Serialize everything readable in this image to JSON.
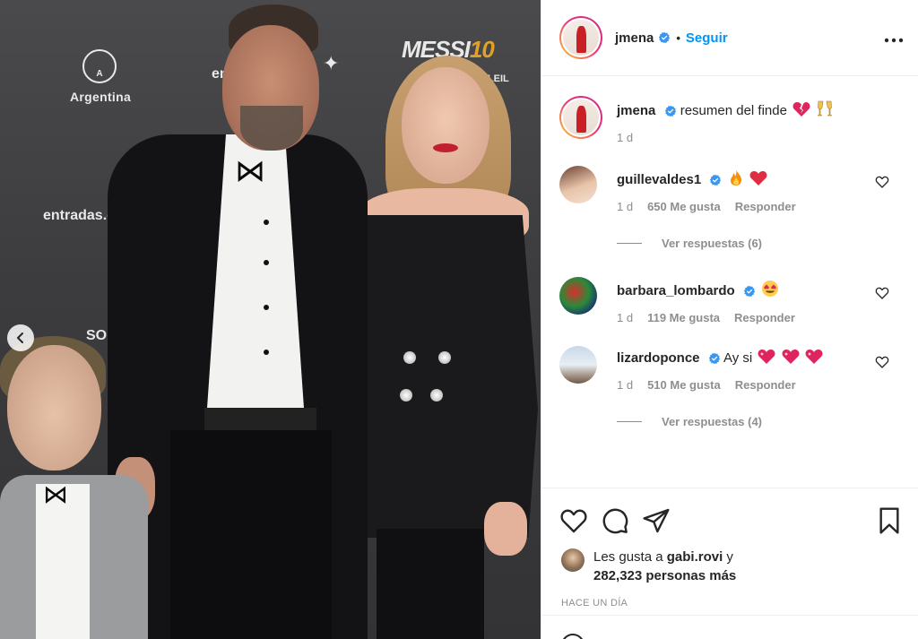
{
  "post": {
    "author": "jmena",
    "follow_label": "Seguir",
    "separator": "•",
    "more_label": "•••"
  },
  "photo": {
    "brands": {
      "argentina": "Argentina",
      "logo_letter": "A",
      "messi": "MESSI",
      "messi_ten": "10",
      "soleil": "SOLEIL",
      "entradas": "entradas.com",
      "entradas2": "entr",
      "so": "SO"
    }
  },
  "caption": {
    "username": "jmena",
    "text": "resumen del finde",
    "emojis": [
      "broken-heart",
      "champagne-toast"
    ],
    "time": "1 d"
  },
  "comments": [
    {
      "username": "guillevaldes1",
      "verified": true,
      "text": "",
      "emojis": [
        "fire",
        "red-heart"
      ],
      "time": "1 d",
      "likes": "650 Me gusta",
      "reply": "Responder",
      "view_replies": "Ver respuestas (6)"
    },
    {
      "username": "barbara_lombardo",
      "verified": true,
      "text": "",
      "emojis": [
        "heart-eyes"
      ],
      "time": "1 d",
      "likes": "119 Me gusta",
      "reply": "Responder"
    },
    {
      "username": "lizardoponce",
      "verified": true,
      "text": "Ay si",
      "emojis": [
        "sparkling-heart",
        "sparkling-heart",
        "sparkling-heart"
      ],
      "time": "1 d",
      "likes": "510 Me gusta",
      "reply": "Responder",
      "view_replies": "Ver respuestas (4)"
    }
  ],
  "likes": {
    "prefix": "Les gusta a",
    "user": "gabi.rovi",
    "joiner": "y",
    "others": "282,323 personas más"
  },
  "timestamp": "HACE UN DÍA",
  "colors": {
    "accent": "#0095f6",
    "verified": "#3897f0",
    "muted": "#8e8e8e",
    "text": "#262626",
    "border": "#efefef"
  }
}
